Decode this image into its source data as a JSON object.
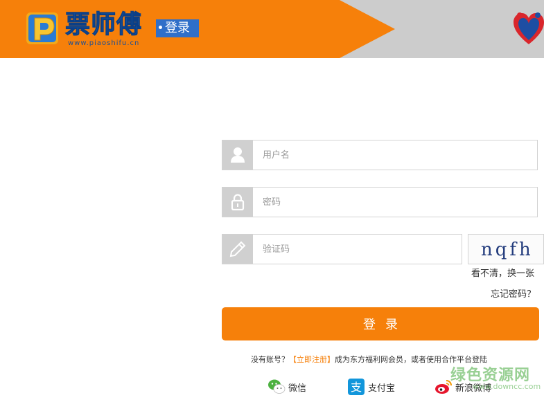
{
  "header": {
    "brand_name": "票师傅",
    "brand_url": "www.piaoshifu.cn",
    "page_tag": "登录"
  },
  "form": {
    "username_placeholder": "用户名",
    "password_placeholder": "密码",
    "captcha_placeholder": "验证码",
    "captcha_text": "nqfh",
    "refresh_label": "看不清，换一张",
    "forgot_label": "忘记密码？",
    "submit_label": "登录"
  },
  "register": {
    "prefix": "没有账号？",
    "link": "【立即注册】",
    "suffix": "成为东方福利网会员，或者使用合作平台登陆"
  },
  "social": {
    "wechat": "微信",
    "alipay": "支付宝",
    "weibo": "新浪微博"
  },
  "watermark": {
    "text": "绿色资源网",
    "url": "www.downcc.com"
  },
  "colors": {
    "accent": "#f6800a",
    "header_gray": "#cccccc",
    "tag_blue": "#2f6fc9"
  }
}
